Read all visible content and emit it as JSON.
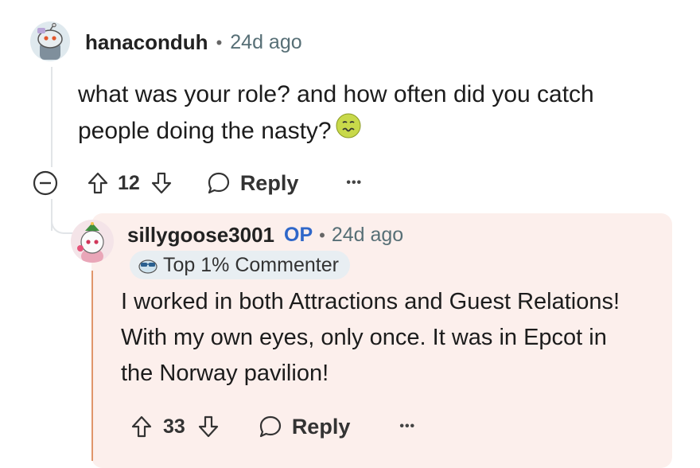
{
  "comment": {
    "username": "hanaconduh",
    "separator": "•",
    "time": "24d ago",
    "text_line1": "what was your role? and how often did you catch",
    "text_line2": "people doing the nasty?",
    "emoji": "nauseated-face",
    "votes": "12",
    "reply_label": "Reply",
    "more_label": "•••",
    "collapse_icon": "minus-circle-icon"
  },
  "reply": {
    "username": "sillygoose3001",
    "op_tag": "OP",
    "separator": "•",
    "time": "24d ago",
    "badge_label": "Top 1% Commenter",
    "badge_icon": "sunglasses-snoo-icon",
    "text_line1": "I worked in both Attractions and Guest Relations!",
    "text_line2": "With my own eyes, only once. It was in Epcot in",
    "text_line3": "the Norway pavilion!",
    "votes": "33",
    "reply_label": "Reply",
    "more_label": "•••"
  },
  "colors": {
    "op_blue": "#2f67c9",
    "reply_bg": "#fcefec",
    "highlight_border": "#e0956b",
    "thread_line": "#e2e5e8"
  }
}
